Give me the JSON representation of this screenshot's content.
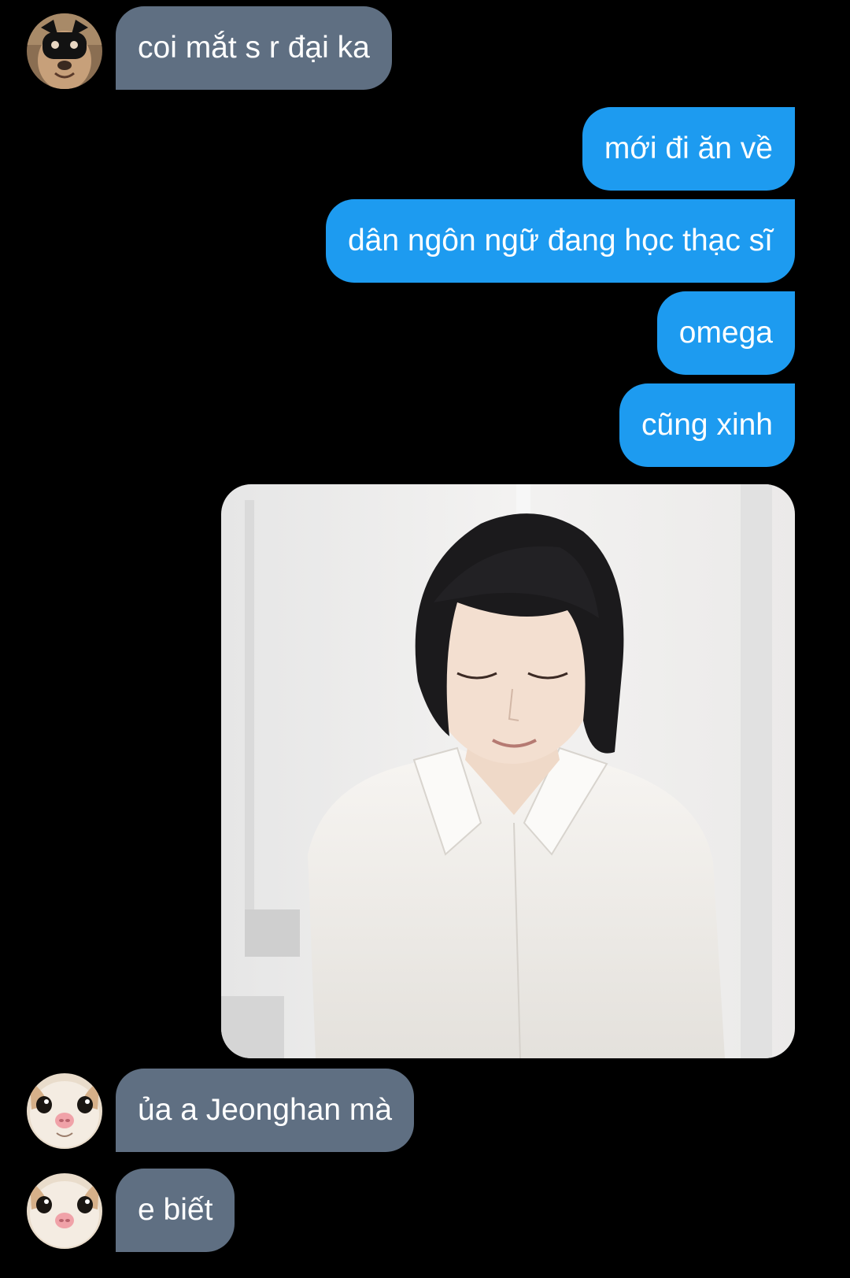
{
  "colors": {
    "background": "#000000",
    "incoming_bubble": "#5f6f82",
    "outgoing_bubble": "#1d9bf0",
    "text": "#ffffff"
  },
  "messages": [
    {
      "direction": "incoming",
      "text": "coi mắt s r đại ka"
    },
    {
      "direction": "outgoing",
      "text": "mới đi ăn về"
    },
    {
      "direction": "outgoing",
      "text": "dân ngôn ngữ đang học thạc sĩ"
    },
    {
      "direction": "outgoing",
      "text": "omega"
    },
    {
      "direction": "outgoing",
      "text": "cũng xinh"
    },
    {
      "direction": "outgoing",
      "type": "photo"
    },
    {
      "direction": "incoming",
      "text": "ủa a Jeonghan mà"
    },
    {
      "direction": "incoming",
      "text": "e biết"
    }
  ]
}
